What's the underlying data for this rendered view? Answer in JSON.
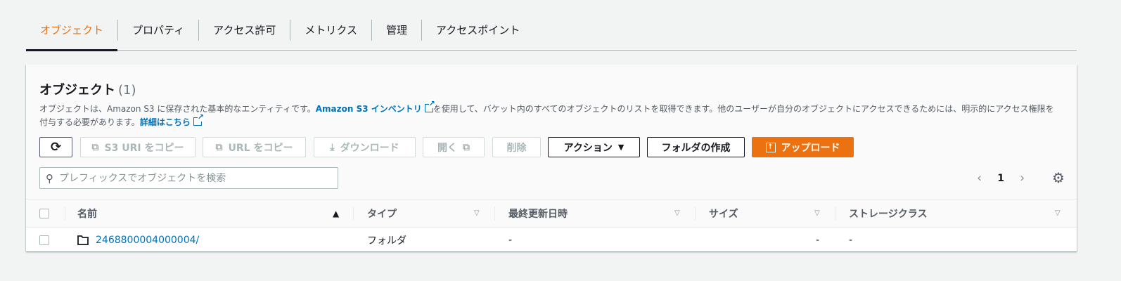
{
  "tabs": [
    {
      "label": "オブジェクト",
      "active": true
    },
    {
      "label": "プロパティ",
      "active": false
    },
    {
      "label": "アクセス許可",
      "active": false
    },
    {
      "label": "メトリクス",
      "active": false
    },
    {
      "label": "管理",
      "active": false
    },
    {
      "label": "アクセスポイント",
      "active": false
    }
  ],
  "panel": {
    "title": "オブジェクト",
    "count": "(1)",
    "desc_1": "オブジェクトは、Amazon S3 に保存された基本的なエンティティです。",
    "desc_link_1": "Amazon S3 インベントリ",
    "desc_2": "を使用して、バケット内のすべてのオブジェクトのリストを取得できます。他のユーザーが自分のオブジェクトにアクセスできるためには、明示的にアクセス権限を付与する必要があります。",
    "desc_link_2": "詳細はこちら"
  },
  "toolbar": {
    "refresh_icon": "refresh-icon",
    "copy_s3_uri": "S3 URI をコピー",
    "copy_url": "URL をコピー",
    "download": "ダウンロード",
    "open": "開く",
    "delete": "削除",
    "actions": "アクション",
    "create_folder": "フォルダの作成",
    "upload": "アップロード"
  },
  "search": {
    "placeholder": "プレフィックスでオブジェクトを検索",
    "value": ""
  },
  "pager": {
    "page": "1"
  },
  "table": {
    "columns": [
      "名前",
      "タイプ",
      "最終更新日時",
      "サイズ",
      "ストレージクラス"
    ],
    "rows": [
      {
        "name": "2468800004000004/",
        "type": "フォルダ",
        "last_modified": "-",
        "size": "-",
        "storage_class": "-"
      }
    ]
  },
  "colors": {
    "accent": "#ec7211",
    "link": "#0073bb"
  }
}
